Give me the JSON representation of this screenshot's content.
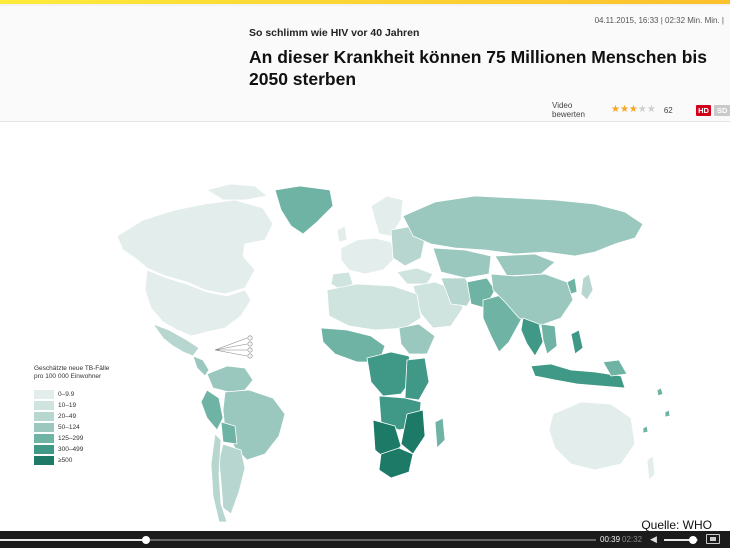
{
  "header": {
    "timestamp": "04.11.2015, 16:33 | 02:32 Min. Min. |",
    "kicker": "So schlimm wie HIV vor 40 Jahren",
    "headline": "An dieser Krankheit können 75 Millionen Menschen bis 2050 sterben"
  },
  "rating": {
    "label": "Video bewerten",
    "stars_filled": 3,
    "stars_total": 5,
    "count": "62",
    "hd_label": "HD",
    "sd_label": "SD"
  },
  "video": {
    "legend": {
      "title": "Geschätzte neue TB-Fälle pro 100 000 Einwohner",
      "items": [
        {
          "label": "0–9.9",
          "color": "#e3eeec"
        },
        {
          "label": "10–19",
          "color": "#cfe3df"
        },
        {
          "label": "20–49",
          "color": "#b6d6cf"
        },
        {
          "label": "50–124",
          "color": "#9ac8be"
        },
        {
          "label": "125–299",
          "color": "#6fb3a5"
        },
        {
          "label": "300–499",
          "color": "#3f9986"
        },
        {
          "label": "≥500",
          "color": "#1c7a67"
        }
      ]
    },
    "source": "Quelle: WHO"
  },
  "controls": {
    "current_time": "00:39",
    "total_time": "02:32",
    "progress": 0.245,
    "volume": 0.85
  }
}
